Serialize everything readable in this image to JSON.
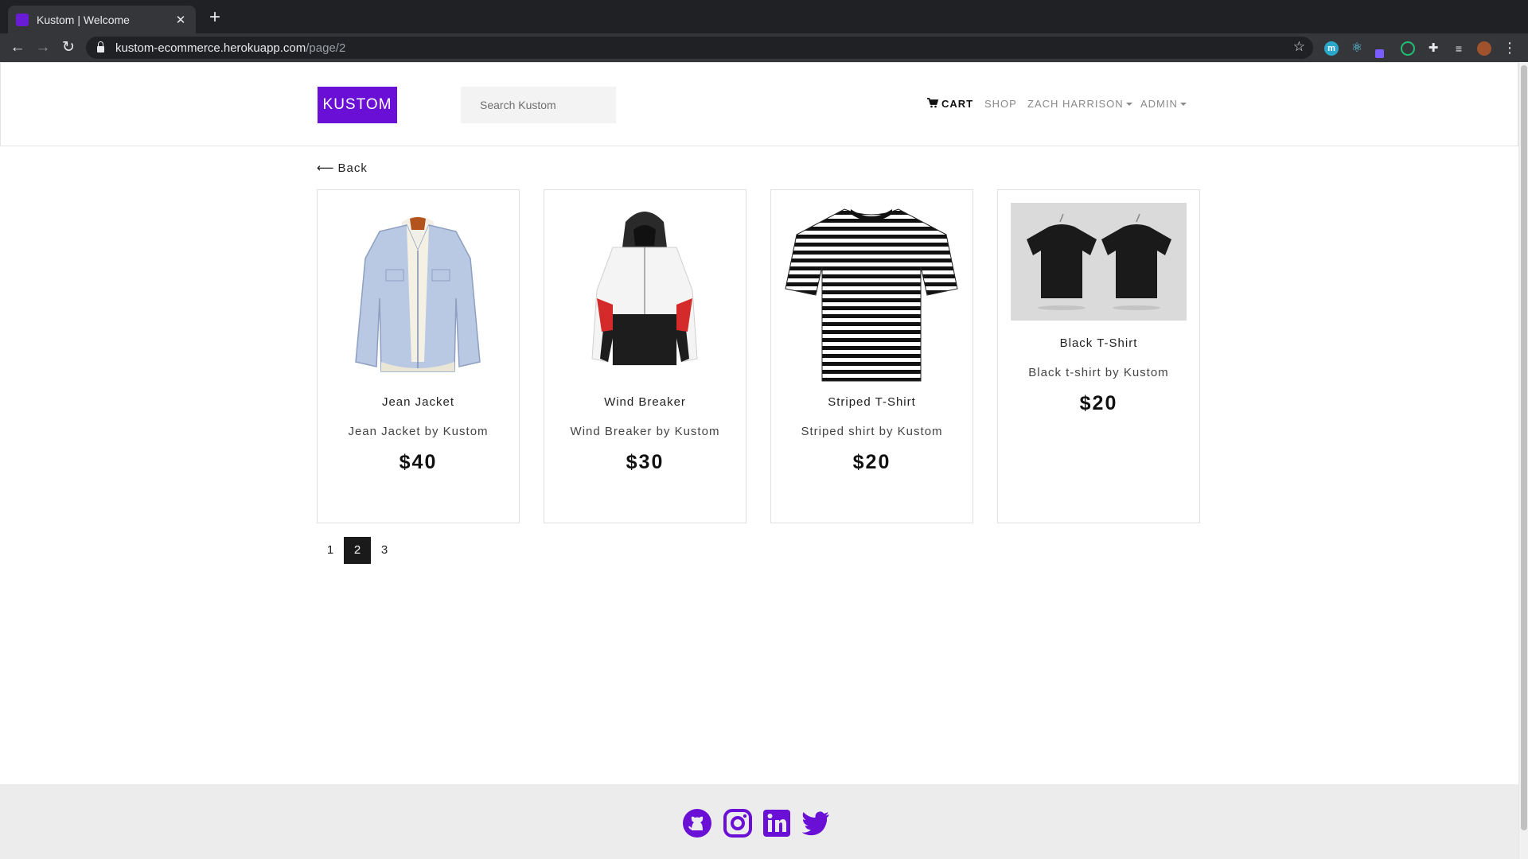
{
  "browser": {
    "tab_title": "Kustom | Welcome",
    "url_host": "kustom-ecommerce.herokuapp.com",
    "url_path": "/page/2"
  },
  "header": {
    "brand": "KUSTOM",
    "search_placeholder": "Search Kustom",
    "nav": {
      "cart": "CART",
      "shop": "SHOP",
      "user": "ZACH HARRISON",
      "admin": "ADMIN"
    }
  },
  "back_label": "Back",
  "products": [
    {
      "name": "Jean Jacket",
      "description": "Jean Jacket by Kustom",
      "price": "$40",
      "image_icon": "jean-jacket-image"
    },
    {
      "name": "Wind Breaker",
      "description": "Wind Breaker by Kustom",
      "price": "$30",
      "image_icon": "wind-breaker-image"
    },
    {
      "name": "Striped T-Shirt",
      "description": "Striped shirt by Kustom",
      "price": "$20",
      "image_icon": "striped-tshirt-image"
    },
    {
      "name": "Black T-Shirt",
      "description": "Black t-shirt by Kustom",
      "price": "$20",
      "image_icon": "black-tshirt-image"
    }
  ],
  "pagination": {
    "pages": [
      "1",
      "2",
      "3"
    ],
    "current": "2"
  },
  "footer": {
    "icons": [
      "github-icon",
      "instagram-icon",
      "linkedin-icon",
      "twitter-icon"
    ]
  },
  "colors": {
    "brand": "#6a0fd6",
    "footer_bg": "#ececec",
    "active_page": "#1a1a1a"
  }
}
